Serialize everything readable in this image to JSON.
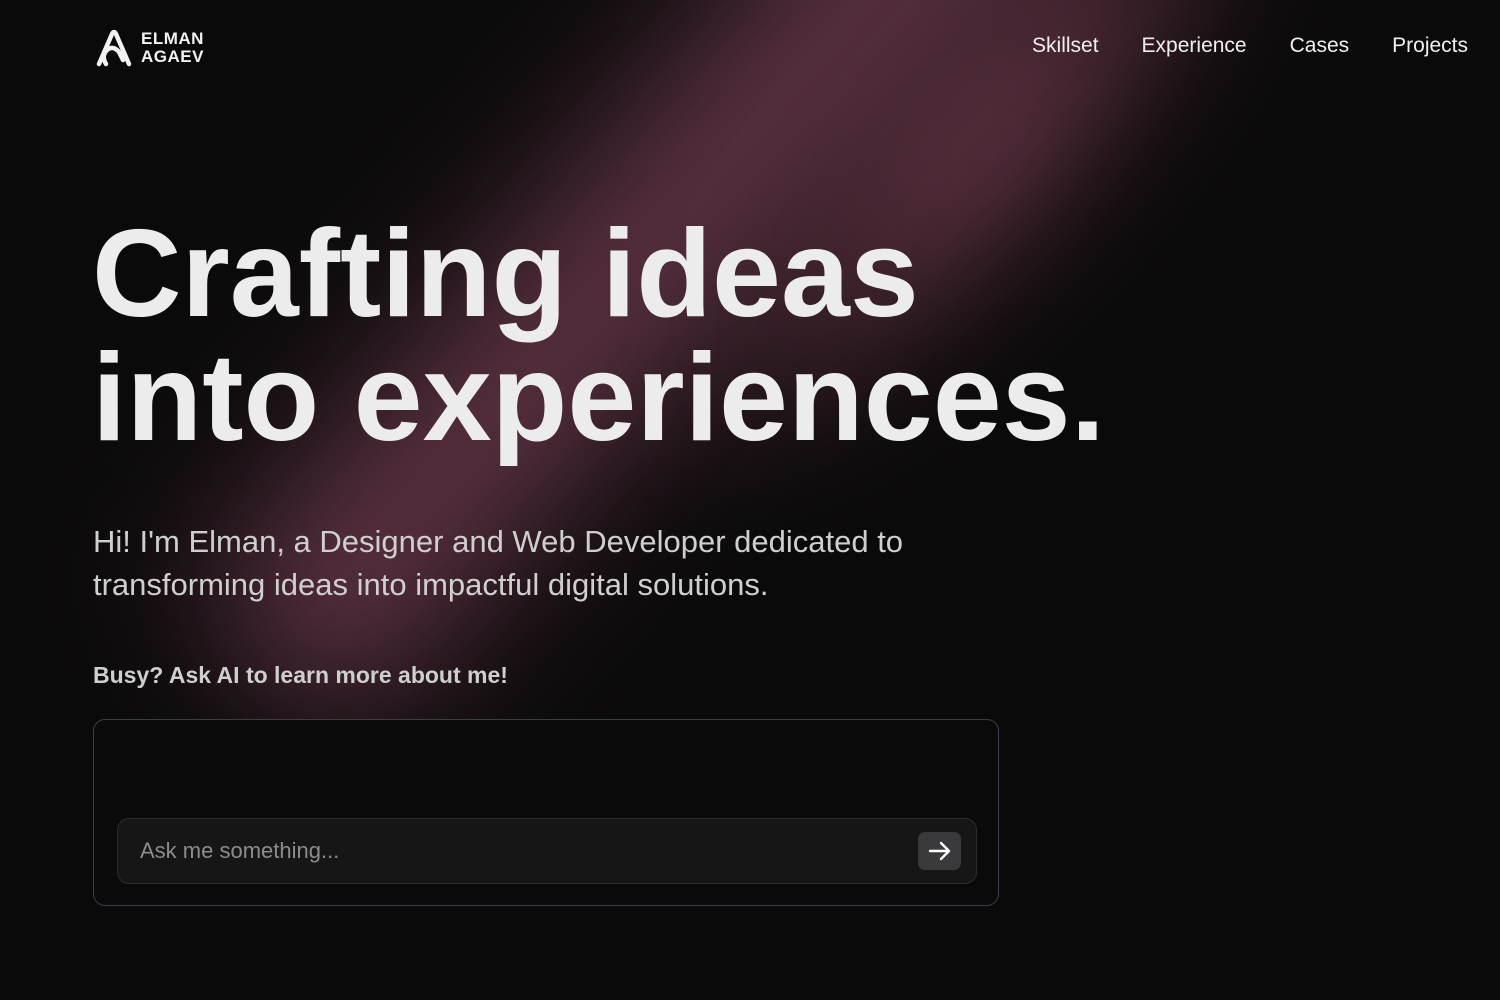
{
  "brand": {
    "line1": "ELMAN",
    "line2": "AGAEV",
    "logo_icon": "ea-logo-icon"
  },
  "nav": {
    "items": [
      {
        "label": "Skillset"
      },
      {
        "label": "Experience"
      },
      {
        "label": "Cases"
      },
      {
        "label": "Projects"
      }
    ]
  },
  "hero": {
    "title_line1": "Crafting ideas",
    "title_line2": "into experiences.",
    "subtitle": "Hi! I'm Elman, a Designer and Web Developer dedicated to transforming ideas into impactful digital solutions."
  },
  "ask_ai": {
    "label": "Busy? Ask AI to learn more about me!",
    "input_placeholder": "Ask me something...",
    "input_value": "",
    "send_icon": "arrow-right-icon"
  },
  "colors": {
    "background": "#0b0a0b",
    "glow": "#8c4864",
    "text": "#ececec",
    "chat_border": "#3a3d4a",
    "send_button": "#3a3a3c"
  }
}
